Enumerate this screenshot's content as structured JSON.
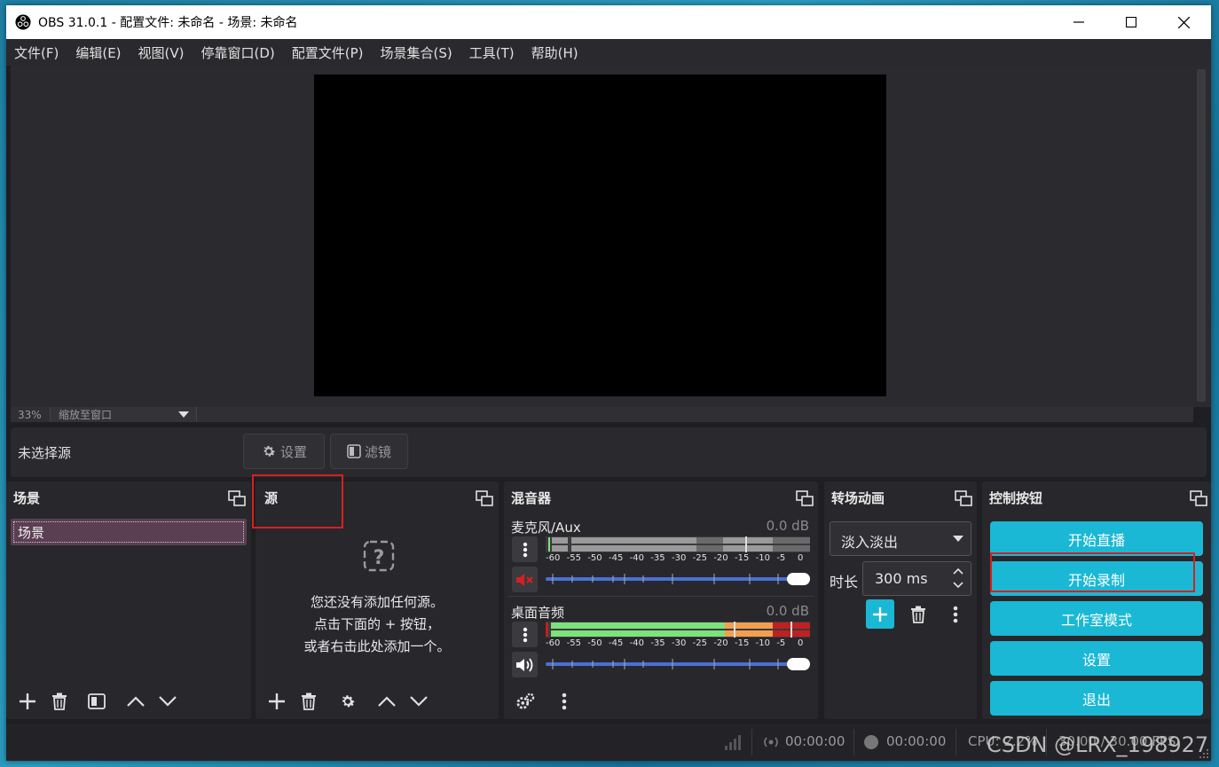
{
  "window": {
    "title": "OBS 31.0.1 - 配置文件: 未命名 - 场景: 未命名"
  },
  "menu": [
    "文件(F)",
    "编辑(E)",
    "视图(V)",
    "停靠窗口(D)",
    "配置文件(P)",
    "场景集合(S)",
    "工具(T)",
    "帮助(H)"
  ],
  "preview": {
    "zoom": "33%",
    "zoom_mode": "缩放至窗口"
  },
  "source_bar": {
    "no_source": "未选择源",
    "settings_label": "设置",
    "filters_label": "滤镜"
  },
  "scenes": {
    "title": "场景",
    "items": [
      "场景"
    ]
  },
  "sources": {
    "title": "源",
    "empty_line1": "您还没有添加任何源。",
    "empty_line2": "点击下面的 + 按钮，",
    "empty_line3": "或者右击此处添加一个。"
  },
  "mixer": {
    "title": "混音器",
    "channels": [
      {
        "name": "麦克风/Aux",
        "db": "0.0 dB",
        "muted": true,
        "level": 0.0
      },
      {
        "name": "桌面音频",
        "db": "0.0 dB",
        "muted": false,
        "level": 1.0
      }
    ],
    "ticks": [
      "-60",
      "-55",
      "-50",
      "-45",
      "-40",
      "-35",
      "-30",
      "-25",
      "-20",
      "-15",
      "-10",
      "-5",
      "0"
    ]
  },
  "transitions": {
    "title": "转场动画",
    "selected": "淡入淡出",
    "duration_label": "时长",
    "duration_value": "300 ms"
  },
  "controls": {
    "title": "控制按钮",
    "start_stream": "开始直播",
    "start_record": "开始录制",
    "studio_mode": "工作室模式",
    "settings": "设置",
    "exit": "退出"
  },
  "status": {
    "stream_time": "00:00:00",
    "record_time": "00:00:00",
    "cpu": "CPU: 2.2%",
    "fps": "30.00 / 30.00 FPS"
  },
  "watermark": "CSDN @LRX_198927",
  "colors": {
    "accent": "#1ab8d4",
    "highlight": "#d62020",
    "scene_selected": "#5a3f52",
    "meter_green": "#7ce27c",
    "meter_orange": "#f0a050",
    "meter_red": "#c02020",
    "slider_blue": "#4a6fd6"
  }
}
